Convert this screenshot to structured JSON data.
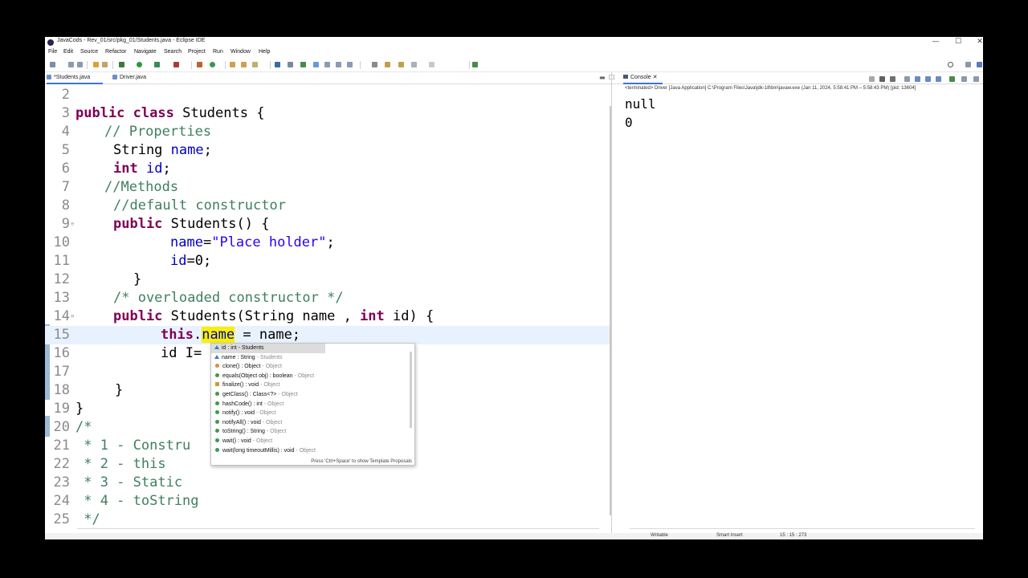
{
  "window": {
    "title": "JavaCods - Rev_01/src/pkg_01/Students.java - Eclipse IDE",
    "minimize": "—",
    "maximize": "☐",
    "close": "✕"
  },
  "menu": [
    "File",
    "Edit",
    "Source",
    "Refactor",
    "Navigate",
    "Search",
    "Project",
    "Run",
    "Window",
    "Help"
  ],
  "editor_tabs": {
    "students": "*Students.java",
    "driver": "Driver.java",
    "close": "✕",
    "min": "▬",
    "max": "☐"
  },
  "code": {
    "l2": "2",
    "l3": "3",
    "l4": "4",
    "l5": "5",
    "l6": "6",
    "l7": "7",
    "l8": "8",
    "l9": "9",
    "l10": "10",
    "l11": "11",
    "l12": "12",
    "l13": "13",
    "l14": "14",
    "l15": "15",
    "l16": "16",
    "l17": "17",
    "l18": "18",
    "l19": "19",
    "l20": "20",
    "l21": "21",
    "l22": "22",
    "l23": "23",
    "l24": "24",
    "l25": "25",
    "kw_public": "public",
    "kw_class": "class",
    "class_rest": " Students {",
    "c_properties": "// Properties",
    "l5_type": "String ",
    "l5_field": "name",
    "l5_end": ";",
    "kw_int": "int",
    "l6_field": " id",
    "l6_end": ";",
    "c_methods": "//Methods",
    "c_default": "//default constructor",
    "ctor1_rest": " Students() {",
    "l10_field": "name",
    "l10_eq": "=",
    "l10_str": "\"Place holder\"",
    "l10_end": ";",
    "l11_field": "id",
    "l11_rest": "=0;",
    "l12_brace": "}",
    "c_overloaded": "/* overloaded constructor */",
    "ctor2_a": " Students(String name , ",
    "ctor2_b": " id) {",
    "kw_this": "this",
    "l15_dot": ".",
    "l15_field": "name",
    "l15_rest": " = name;",
    "l16_text": "id I= i",
    "l18_brace": "}",
    "l19_brace": "}",
    "c20": "/*",
    "c21": " * 1 - Constru",
    "c22": " * 2 - this",
    "c23": " * 3 - Static",
    "c24": " * 4 - toString",
    "c25": " */"
  },
  "assist": {
    "items": [
      {
        "label": "id : int",
        "owner": " - Students"
      },
      {
        "label": "name : String",
        "owner": " - Students"
      },
      {
        "label": "clone() : Object",
        "owner": " - Object"
      },
      {
        "label": "equals(Object obj) : boolean",
        "owner": " - Object"
      },
      {
        "label": "finalize() : void",
        "owner": " - Object"
      },
      {
        "label": "getClass() : Class<?>",
        "owner": " - Object"
      },
      {
        "label": "hashCode() : int",
        "owner": " - Object"
      },
      {
        "label": "notify() : void",
        "owner": " - Object"
      },
      {
        "label": "notifyAll() : void",
        "owner": " - Object"
      },
      {
        "label": "toString() : String",
        "owner": " - Object"
      },
      {
        "label": "wait() : void",
        "owner": " - Object"
      },
      {
        "label": "wait(long timeoutMillis) : void",
        "owner": " - Object"
      }
    ],
    "hint": "Press 'Ctrl+Space' to show Template Proposals"
  },
  "console": {
    "tab": "Console",
    "close": "✕",
    "status": "<terminated> Driver [Java Application] C:\\Program Files\\Java\\jdk-18\\bin\\javaw.exe  (Jan 11, 2024, 5:58:41 PM – 5:58:43 PM) [pid: 13604]",
    "output": [
      "null",
      "0"
    ]
  },
  "status_bar": {
    "writable": "Writable",
    "insert": "Smart Insert",
    "position": "15 : 15 : 273"
  },
  "colors": {
    "keyword": "#7f0055",
    "comment": "#3f7f5f",
    "string": "#2a00ff",
    "field": "#0000c0",
    "highlight": "#f7f000",
    "current_line": "#e8f2fe"
  }
}
